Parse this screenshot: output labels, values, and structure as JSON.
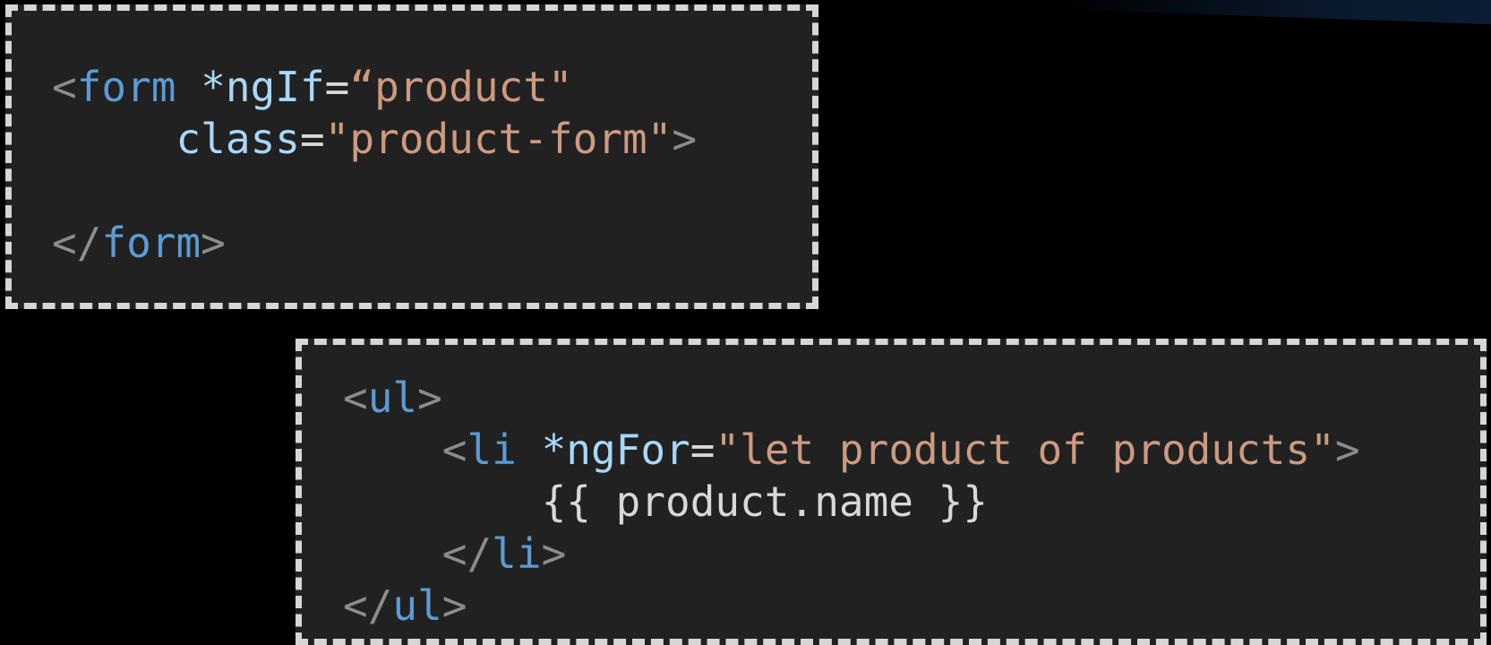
{
  "colors": {
    "background": "#000000",
    "panel": "#212121",
    "border": "#d6d6d6",
    "punctuation": "#8c8c8c",
    "tag": "#5b9bd5",
    "attribute": "#a8d8f8",
    "string": "#cd9a80",
    "text": "#d8d8d8"
  },
  "snippets": [
    {
      "id": "form",
      "lines": [
        [
          {
            "t": "<",
            "k": "punct"
          },
          {
            "t": "form",
            "k": "tag"
          },
          {
            "t": " ",
            "k": "text"
          },
          {
            "t": "*ngIf",
            "k": "attr"
          },
          {
            "t": "=",
            "k": "text"
          },
          {
            "t": "“product\"",
            "k": "str"
          }
        ],
        [
          {
            "t": "     ",
            "k": "text"
          },
          {
            "t": "class",
            "k": "attr"
          },
          {
            "t": "=",
            "k": "text"
          },
          {
            "t": "\"product-form\"",
            "k": "str"
          },
          {
            "t": ">",
            "k": "punct"
          }
        ],
        [],
        [
          {
            "t": "</",
            "k": "punct"
          },
          {
            "t": "form",
            "k": "tag"
          },
          {
            "t": ">",
            "k": "punct"
          }
        ]
      ]
    },
    {
      "id": "ul",
      "lines": [
        [
          {
            "t": "<",
            "k": "punct"
          },
          {
            "t": "ul",
            "k": "tag"
          },
          {
            "t": ">",
            "k": "punct"
          }
        ],
        [
          {
            "t": "    ",
            "k": "text"
          },
          {
            "t": "<",
            "k": "punct"
          },
          {
            "t": "li",
            "k": "tag"
          },
          {
            "t": " ",
            "k": "text"
          },
          {
            "t": "*ngFor",
            "k": "attr"
          },
          {
            "t": "=",
            "k": "text"
          },
          {
            "t": "\"let product of products\"",
            "k": "str"
          },
          {
            "t": ">",
            "k": "punct"
          }
        ],
        [
          {
            "t": "        ",
            "k": "text"
          },
          {
            "t": "{{ product.name }}",
            "k": "text"
          }
        ],
        [
          {
            "t": "    ",
            "k": "text"
          },
          {
            "t": "</",
            "k": "punct"
          },
          {
            "t": "li",
            "k": "tag"
          },
          {
            "t": ">",
            "k": "punct"
          }
        ],
        [
          {
            "t": "</",
            "k": "punct"
          },
          {
            "t": "ul",
            "k": "tag"
          },
          {
            "t": ">",
            "k": "punct"
          }
        ]
      ]
    }
  ]
}
